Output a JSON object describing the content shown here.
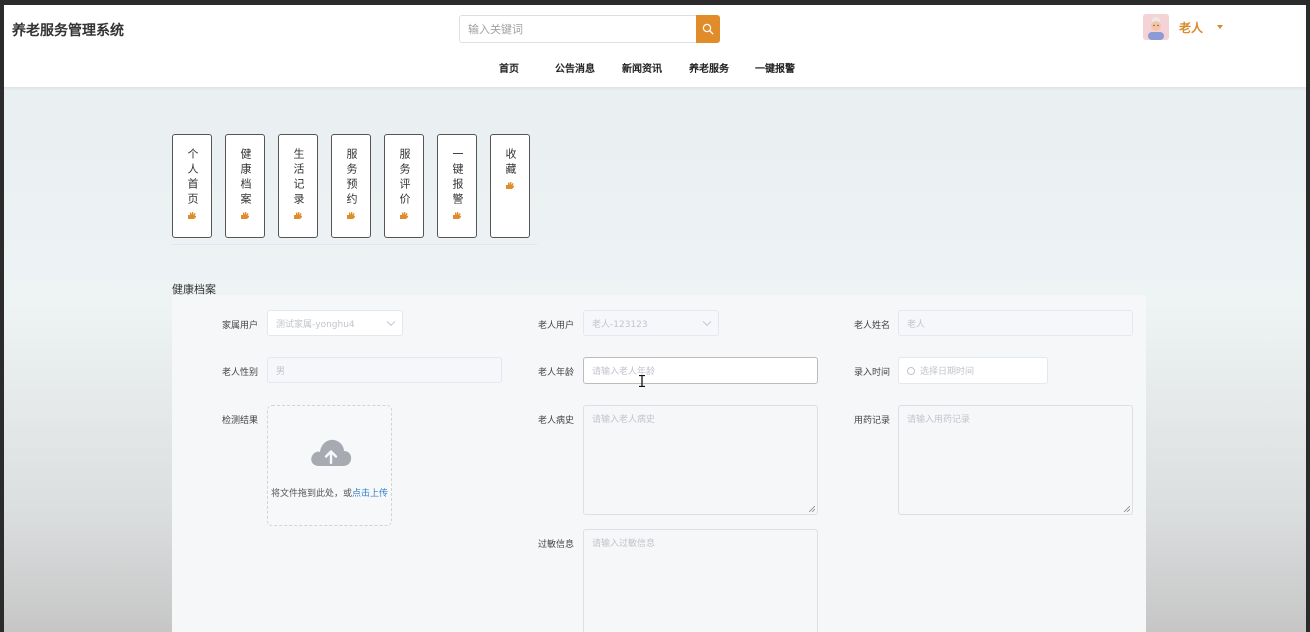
{
  "header": {
    "site_title": "养老服务管理系统",
    "search_placeholder": "输入关键词",
    "username": "老人",
    "nav": [
      "首页",
      "公告消息",
      "新闻资讯",
      "养老服务",
      "一键报警"
    ]
  },
  "tabs": [
    {
      "label": "个人首页"
    },
    {
      "label": "健康档案"
    },
    {
      "label": "生活记录"
    },
    {
      "label": "服务预约"
    },
    {
      "label": "服务评价"
    },
    {
      "label": "一键报警"
    },
    {
      "label": "收藏"
    }
  ],
  "section_title": "健康档案",
  "form": {
    "family_user_label": "家属用户",
    "family_user_value": "测试家属-yonghu4",
    "elder_user_label": "老人用户",
    "elder_user_value": "老人-123123",
    "elder_name_label": "老人姓名",
    "elder_name_value": "老人",
    "elder_gender_label": "老人性别",
    "elder_gender_value": "男",
    "elder_age_label": "老人年龄",
    "elder_age_placeholder": "请输入老人年龄",
    "entry_time_label": "录入时间",
    "entry_time_placeholder": "选择日期时间",
    "test_result_label": "检测结果",
    "upload_text": "将文件拖到此处，或",
    "upload_link": "点击上传",
    "medical_history_label": "老人病史",
    "medical_history_placeholder": "请输入老人病史",
    "medication_label": "用药记录",
    "medication_placeholder": "请输入用药记录",
    "allergy_label": "过敏信息",
    "allergy_placeholder": "请输入过敏信息"
  },
  "colors": {
    "accent": "#e08c2b",
    "username": "#d98a2c",
    "link": "#2f7ecb"
  }
}
